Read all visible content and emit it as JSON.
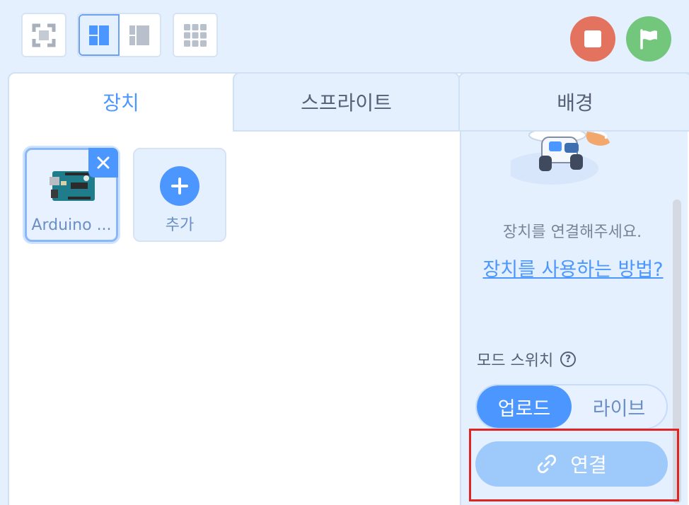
{
  "toolbar": {
    "fullscreen_icon": "fullscreen-icon",
    "layout_icons": [
      "layout-large-stage-icon",
      "layout-small-stage-icon"
    ],
    "grid_icon": "grid-icon",
    "stop_icon": "stop-icon",
    "go_icon": "green-flag-icon",
    "colors": {
      "stop": "#e3735f",
      "go": "#72c77c"
    }
  },
  "tabs": [
    {
      "label": "장치",
      "active": true
    },
    {
      "label": "스프라이트",
      "active": false
    },
    {
      "label": "배경",
      "active": false
    }
  ],
  "devices": [
    {
      "label": "Arduino ...",
      "selected": true
    }
  ],
  "add_button": {
    "label": "추가"
  },
  "side_panel": {
    "message": "장치를 연결해주세요.",
    "help_link": "장치를 사용하는 방법?",
    "mode_label": "모드 스위치",
    "modes": [
      {
        "label": "업로드",
        "active": true
      },
      {
        "label": "라이브",
        "active": false
      }
    ],
    "connect_label": "연결"
  },
  "accent_color": "#4c97ff"
}
